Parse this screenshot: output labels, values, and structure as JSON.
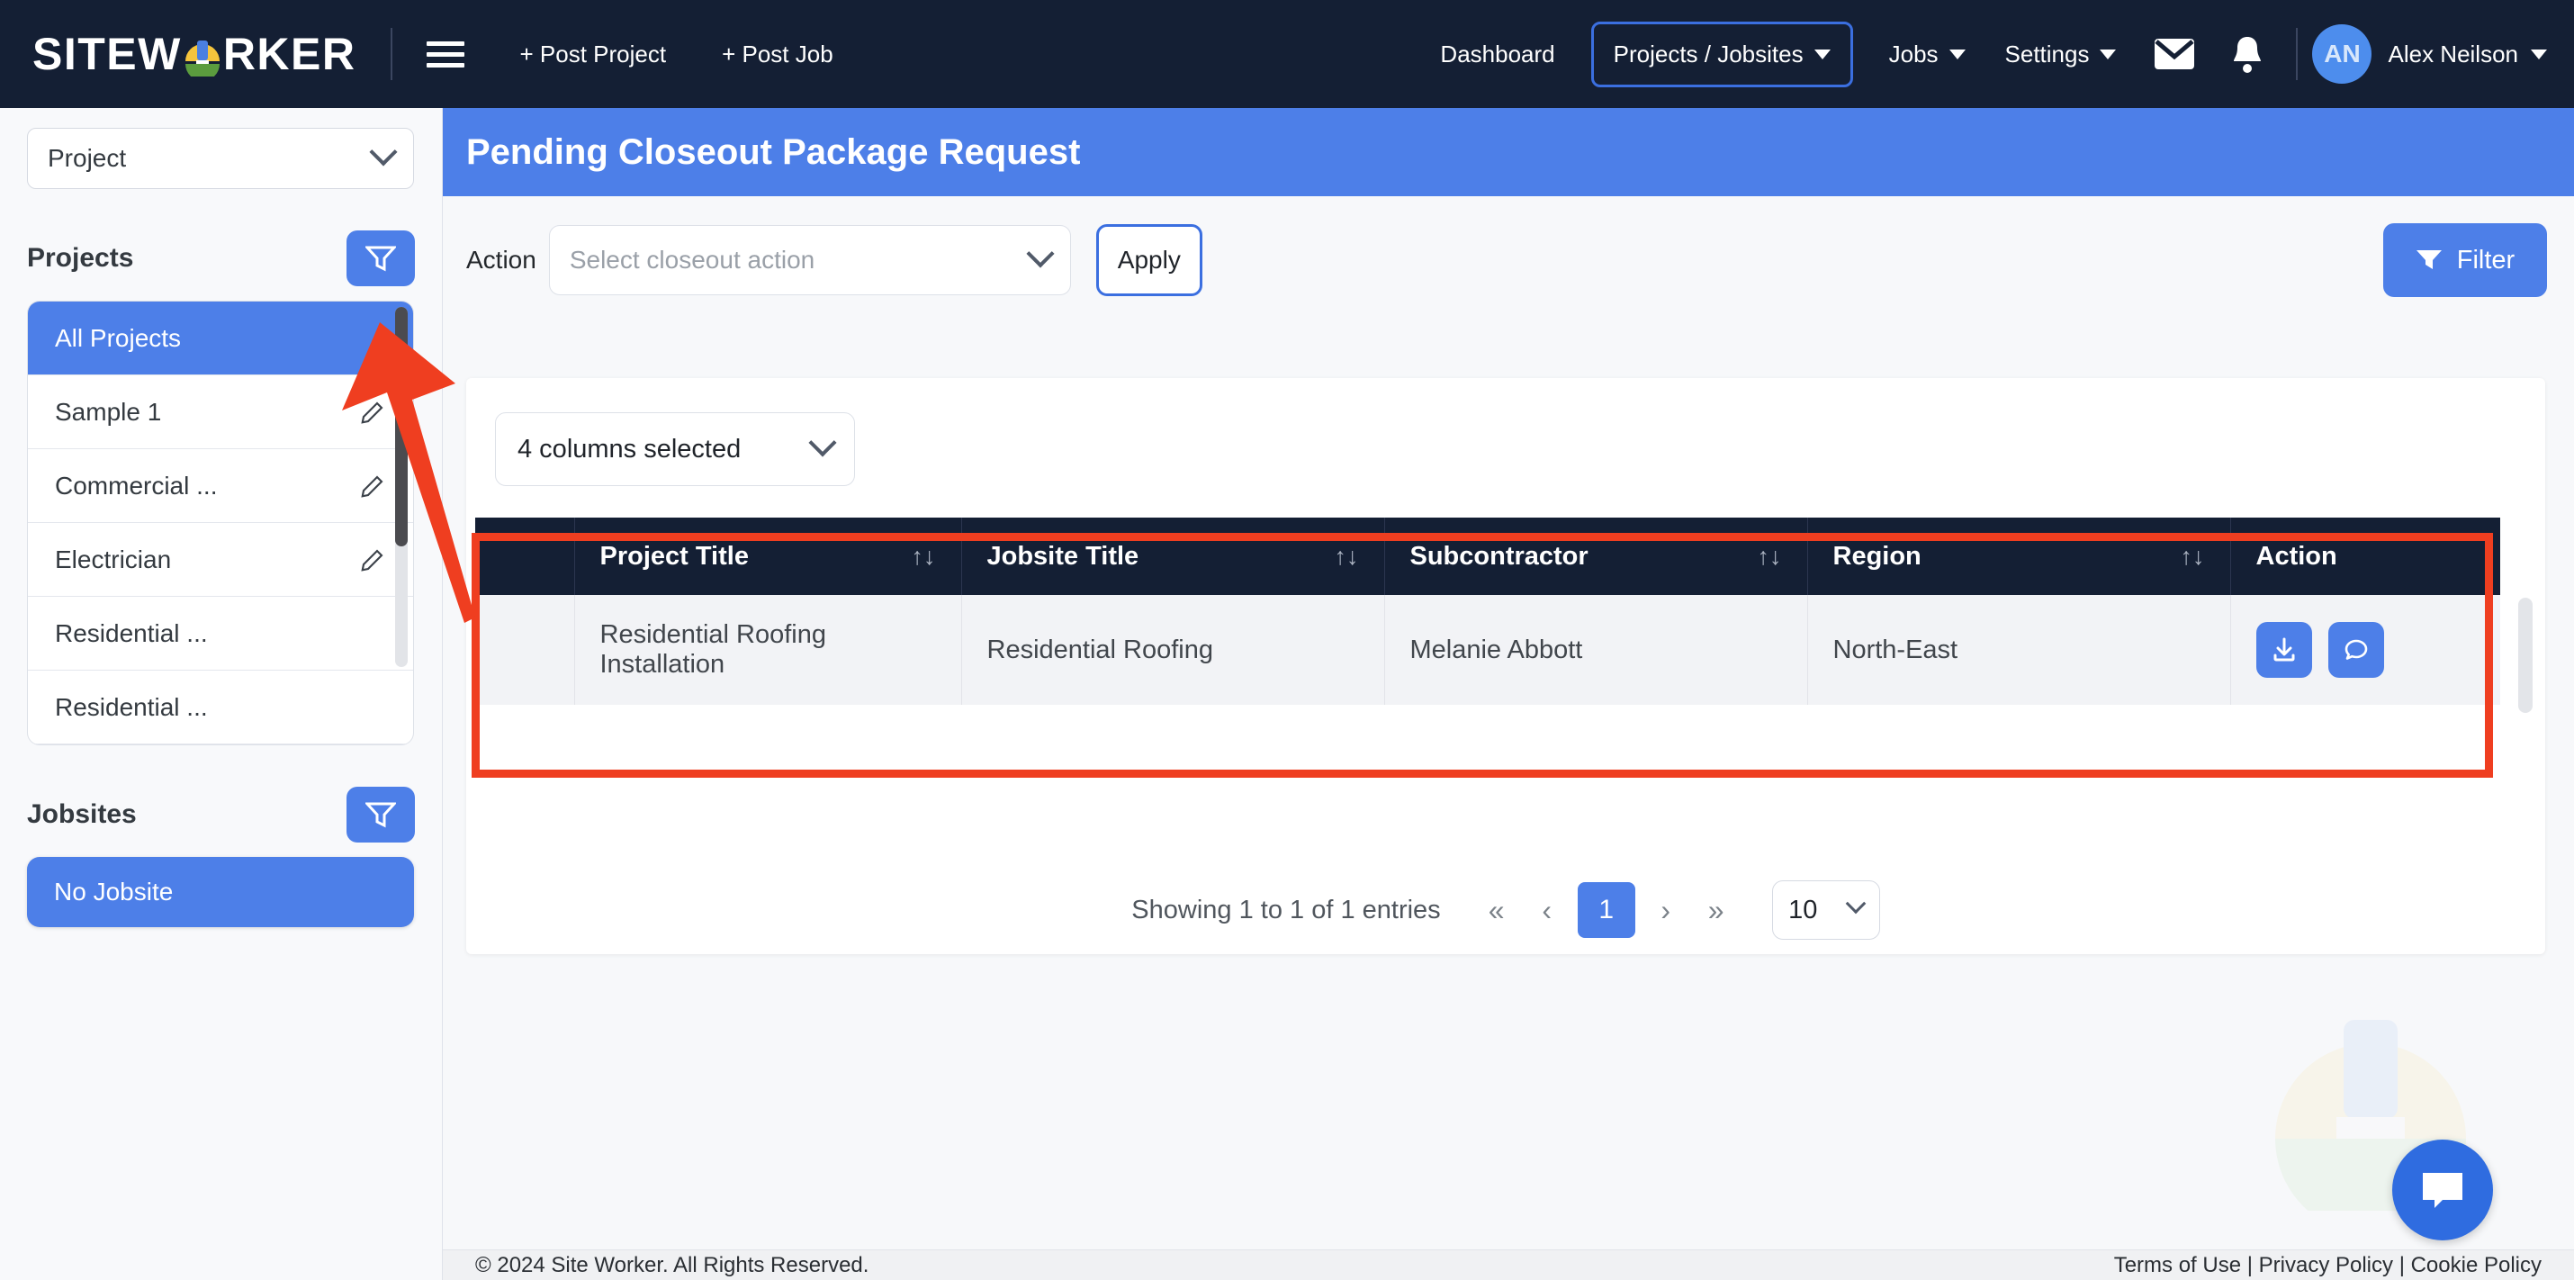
{
  "brand": {
    "name_pre": "SITEW",
    "name_post": "RKER",
    "accent": "#4d7fe8",
    "dark": "#141f34"
  },
  "topnav": {
    "menu_icon": "hamburger-icon",
    "post_project": "+ Post Project",
    "post_job": "+ Post Job",
    "links": [
      {
        "label": "Dashboard",
        "active": false,
        "caret": false
      },
      {
        "label": "Projects / Jobsites",
        "active": true,
        "caret": true
      },
      {
        "label": "Jobs",
        "active": false,
        "caret": true
      },
      {
        "label": "Settings",
        "active": false,
        "caret": true
      }
    ],
    "mail_icon": "envelope-icon",
    "bell_icon": "bell-icon",
    "avatar_initials": "AN",
    "user_name": "Alex Neilson"
  },
  "sidebar": {
    "type_select": {
      "value": "Project"
    },
    "projects": {
      "title": "Projects",
      "filter_icon": "funnel-icon",
      "items": [
        {
          "label": "All Projects",
          "selected": true,
          "editable": false
        },
        {
          "label": "Sample 1",
          "selected": false,
          "editable": true
        },
        {
          "label": "Commercial ...",
          "selected": false,
          "editable": true
        },
        {
          "label": "Electrician",
          "selected": false,
          "editable": true
        },
        {
          "label": "Residential ...",
          "selected": false,
          "editable": false
        },
        {
          "label": "Residential ...",
          "selected": false,
          "editable": false
        }
      ]
    },
    "jobsites": {
      "title": "Jobsites",
      "filter_icon": "funnel-icon",
      "selected": "No Jobsite"
    }
  },
  "main": {
    "page_title": "Pending Closeout Package Request",
    "action_label": "Action",
    "action_select_placeholder": "Select closeout action",
    "apply_label": "Apply",
    "filter_label": "Filter",
    "columns_select": "4 columns selected",
    "table": {
      "headers": [
        "",
        "Project Title",
        "Jobsite Title",
        "Subcontractor",
        "Region",
        "Action"
      ],
      "sortable": [
        false,
        true,
        true,
        true,
        true,
        false
      ],
      "sort_glyph": "↑↓",
      "rows": [
        {
          "checkbox": "",
          "project_title": "Residential Roofing Installation",
          "jobsite_title": "Residential Roofing",
          "subcontractor": "Melanie Abbott",
          "region": "North-East",
          "actions": [
            "download-icon",
            "comment-icon"
          ]
        }
      ]
    },
    "pagination": {
      "showing": "Showing 1 to 1 of 1 entries",
      "first": "«",
      "prev": "‹",
      "pages": [
        "1"
      ],
      "current_page": "1",
      "next": "›",
      "last": "»",
      "per_page": "10"
    }
  },
  "chat_widget": {
    "icon": "chat-bubble-icon"
  },
  "footer": {
    "copyright": "© 2024 Site Worker. All Rights Reserved.",
    "links": [
      "Terms of Use",
      "Privacy Policy",
      "Cookie Policy"
    ],
    "separator": " | "
  },
  "annotations": {
    "arrow_color": "#ef3e20",
    "box_color": "#ef3e20"
  }
}
